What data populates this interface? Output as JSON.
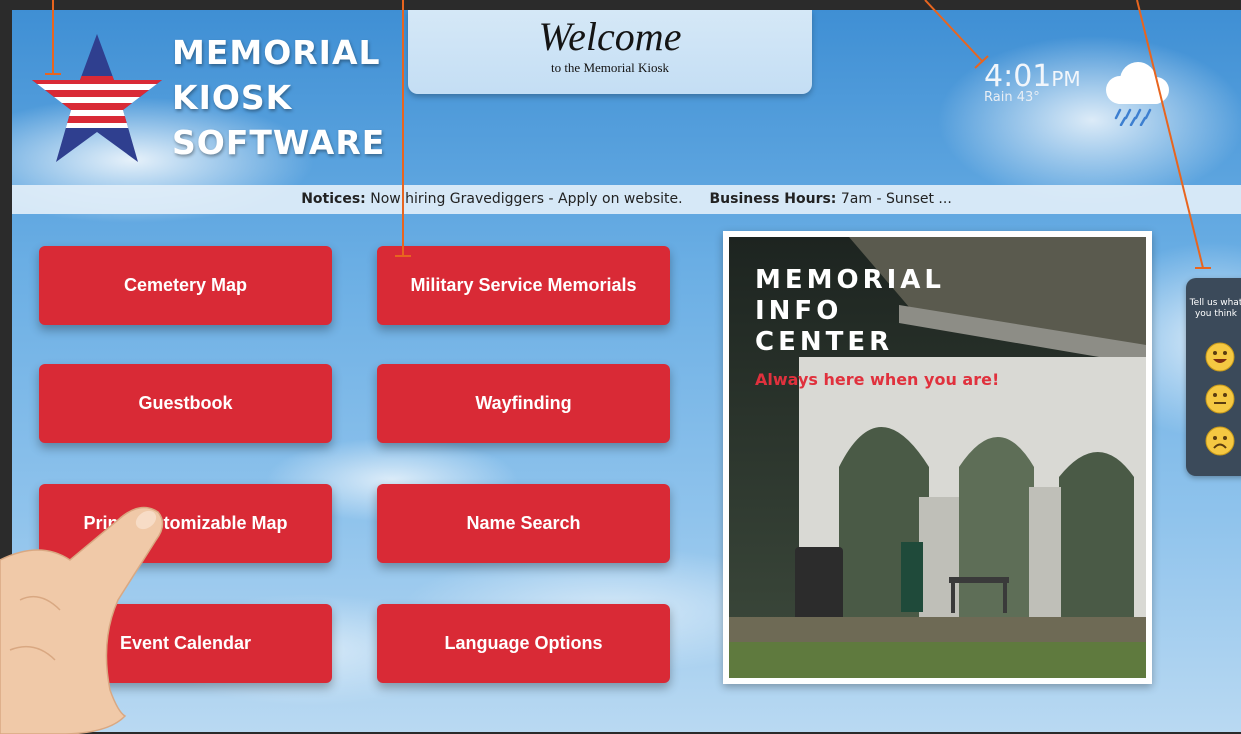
{
  "logo": {
    "lines": [
      "MEMORIAL",
      "KIOSK",
      "SOFTWARE"
    ]
  },
  "welcome": {
    "title": "Welcome",
    "subtitle": "to the Memorial Kiosk"
  },
  "weather": {
    "time": "4:01",
    "ampm": "PM",
    "condition": "Rain 43°",
    "icon": "rain-cloud-icon"
  },
  "notice_bar": {
    "notices_label": "Notices:",
    "notices_text": "Now hiring Gravediggers - Apply on website.",
    "hours_label": "Business Hours:",
    "hours_text": "7am - Sunset ..."
  },
  "menu": {
    "cemetery_map": "Cemetery Map",
    "military_service_memorials": "Military Service Memorials",
    "guestbook": "Guestbook",
    "wayfinding": "Wayfinding",
    "print_customizable_map": "Print Customizable Map",
    "name_search": "Name Search",
    "event_calendar": "Event Calendar",
    "language_options": "Language Options"
  },
  "info_center": {
    "title_lines": [
      "MEMORIAL",
      "INFO",
      "CENTER"
    ],
    "tagline": "Always here when you are!"
  },
  "feedback": {
    "label": "Tell us what you think",
    "options": [
      "happy-face-icon",
      "neutral-face-icon",
      "sad-face-icon"
    ]
  },
  "colors": {
    "button_red": "#d92a36",
    "annotation_orange": "#e8651f",
    "sky_blue": "#6aaee4",
    "feedback_panel": "#3b4a5a"
  }
}
